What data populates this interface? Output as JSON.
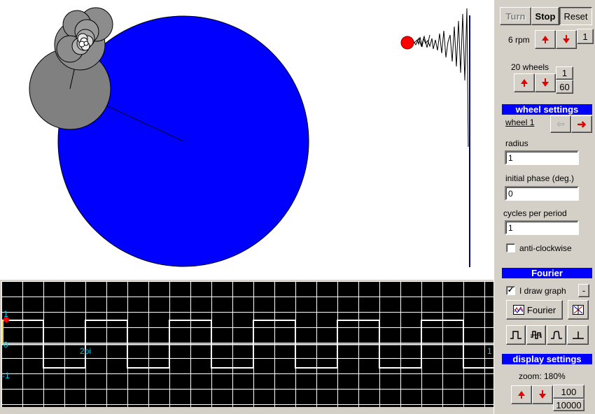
{
  "controls": {
    "turn_label": "Turn",
    "stop_label": "Stop",
    "reset_label": "Reset"
  },
  "speed": {
    "value_label": "6 rpm",
    "step": "1"
  },
  "wheels": {
    "count_label": "20 wheels",
    "step_small": "1",
    "step_large": "60"
  },
  "wheel_settings": {
    "header": "wheel settings",
    "current_wheel": "wheel 1",
    "radius_label": "radius",
    "radius_value": "1",
    "phase_label": "initial phase (deg.)",
    "phase_value": "0",
    "cycles_label": "cycles per period",
    "cycles_value": "1",
    "anticlockwise_label": "anti-clockwise",
    "anticlockwise_checked": false
  },
  "fourier": {
    "header": "Fourier",
    "draw_graph_label": "I draw graph",
    "draw_graph_checked": true,
    "minus_label": "-",
    "fourier_button_label": "Fourier",
    "waveform_icons": [
      "square-wave-icon",
      "sawtooth-wave-icon",
      "pulse-wave-icon",
      "impulse-wave-icon"
    ]
  },
  "display_settings": {
    "header": "display settings",
    "zoom_label": "zoom: 180%",
    "step_small": "100",
    "step_large": "10000"
  },
  "graph": {
    "y_tick_top": "1",
    "y_tick_zero": "0",
    "y_tick_bottom": "-1",
    "x_marker": "2pi",
    "x_edge": "1",
    "background_color": "#000000",
    "grid_color": "#ffffff",
    "label_color": "#00c8e8"
  },
  "colors": {
    "big_wheel": "#0000ff",
    "small_wheels": "#808080",
    "pen_dot": "#ff0000",
    "header_bg": "#0000ff"
  }
}
